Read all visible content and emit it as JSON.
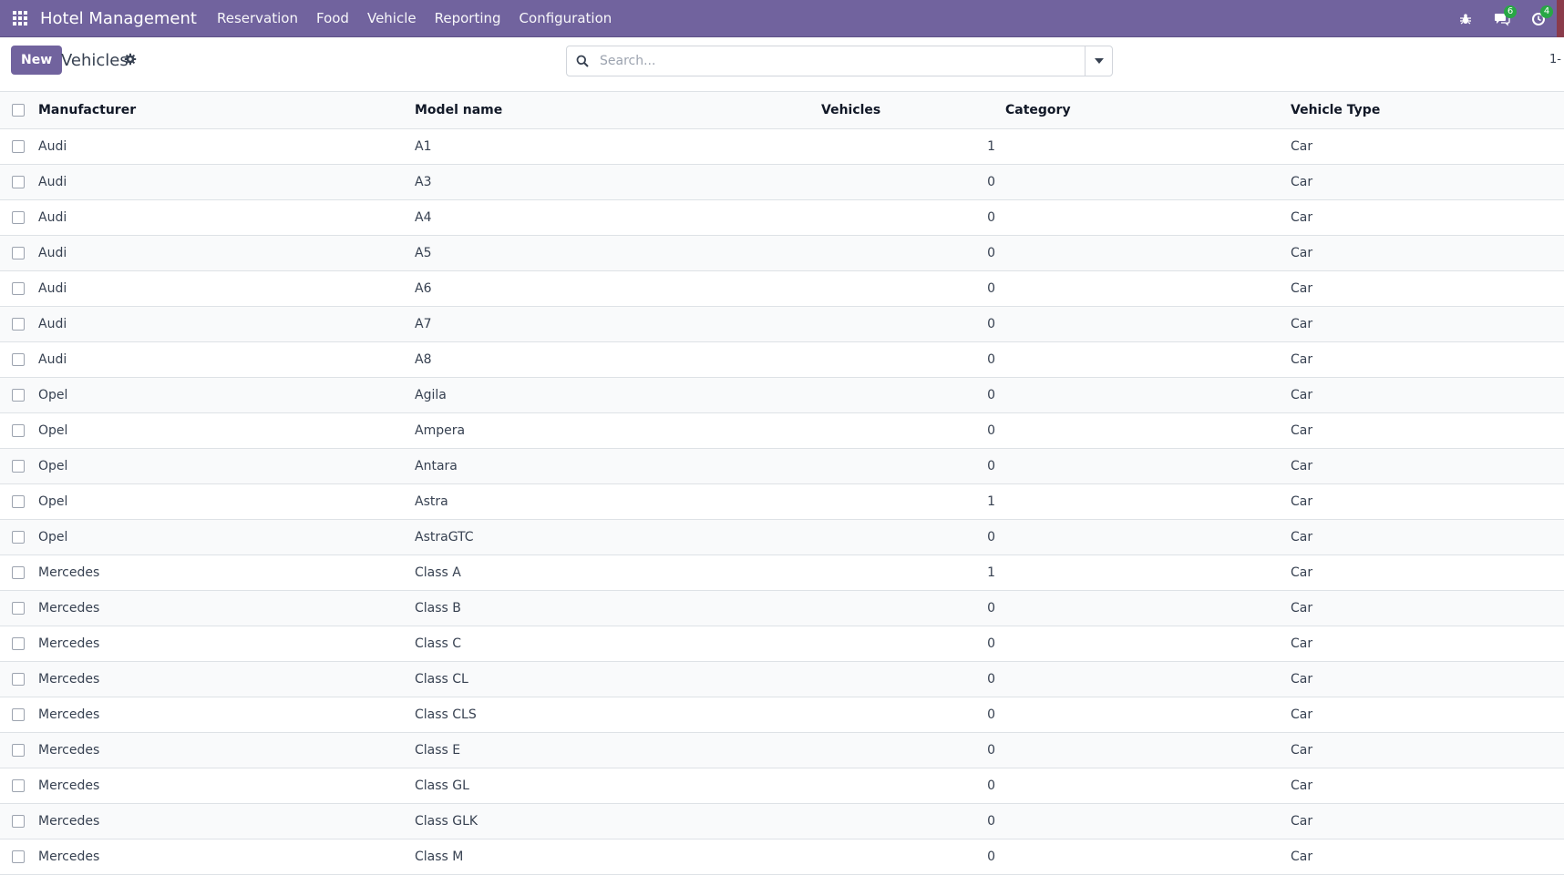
{
  "navbar": {
    "app_title": "Hotel Management",
    "menu": [
      "Reservation",
      "Food",
      "Vehicle",
      "Reporting",
      "Configuration"
    ],
    "messages_count": "6",
    "activities_count": "4"
  },
  "control_panel": {
    "new_label": "New",
    "title": "Vehicles",
    "search_placeholder": "Search...",
    "pager": "1-"
  },
  "table": {
    "headers": {
      "manufacturer": "Manufacturer",
      "model": "Model name",
      "vehicles": "Vehicles",
      "category": "Category",
      "vehicle_type": "Vehicle Type"
    },
    "rows": [
      {
        "manufacturer": "Audi",
        "model": "A1",
        "vehicles": "1",
        "category": "",
        "type": "Car"
      },
      {
        "manufacturer": "Audi",
        "model": "A3",
        "vehicles": "0",
        "category": "",
        "type": "Car"
      },
      {
        "manufacturer": "Audi",
        "model": "A4",
        "vehicles": "0",
        "category": "",
        "type": "Car"
      },
      {
        "manufacturer": "Audi",
        "model": "A5",
        "vehicles": "0",
        "category": "",
        "type": "Car"
      },
      {
        "manufacturer": "Audi",
        "model": "A6",
        "vehicles": "0",
        "category": "",
        "type": "Car"
      },
      {
        "manufacturer": "Audi",
        "model": "A7",
        "vehicles": "0",
        "category": "",
        "type": "Car"
      },
      {
        "manufacturer": "Audi",
        "model": "A8",
        "vehicles": "0",
        "category": "",
        "type": "Car"
      },
      {
        "manufacturer": "Opel",
        "model": "Agila",
        "vehicles": "0",
        "category": "",
        "type": "Car"
      },
      {
        "manufacturer": "Opel",
        "model": "Ampera",
        "vehicles": "0",
        "category": "",
        "type": "Car"
      },
      {
        "manufacturer": "Opel",
        "model": "Antara",
        "vehicles": "0",
        "category": "",
        "type": "Car"
      },
      {
        "manufacturer": "Opel",
        "model": "Astra",
        "vehicles": "1",
        "category": "",
        "type": "Car"
      },
      {
        "manufacturer": "Opel",
        "model": "AstraGTC",
        "vehicles": "0",
        "category": "",
        "type": "Car"
      },
      {
        "manufacturer": "Mercedes",
        "model": "Class A",
        "vehicles": "1",
        "category": "",
        "type": "Car"
      },
      {
        "manufacturer": "Mercedes",
        "model": "Class B",
        "vehicles": "0",
        "category": "",
        "type": "Car"
      },
      {
        "manufacturer": "Mercedes",
        "model": "Class C",
        "vehicles": "0",
        "category": "",
        "type": "Car"
      },
      {
        "manufacturer": "Mercedes",
        "model": "Class CL",
        "vehicles": "0",
        "category": "",
        "type": "Car"
      },
      {
        "manufacturer": "Mercedes",
        "model": "Class CLS",
        "vehicles": "0",
        "category": "",
        "type": "Car"
      },
      {
        "manufacturer": "Mercedes",
        "model": "Class E",
        "vehicles": "0",
        "category": "",
        "type": "Car"
      },
      {
        "manufacturer": "Mercedes",
        "model": "Class GL",
        "vehicles": "0",
        "category": "",
        "type": "Car"
      },
      {
        "manufacturer": "Mercedes",
        "model": "Class GLK",
        "vehicles": "0",
        "category": "",
        "type": "Car"
      },
      {
        "manufacturer": "Mercedes",
        "model": "Class M",
        "vehicles": "0",
        "category": "",
        "type": "Car"
      }
    ]
  },
  "colors": {
    "brand": "#71639e",
    "badge": "#28a745"
  }
}
